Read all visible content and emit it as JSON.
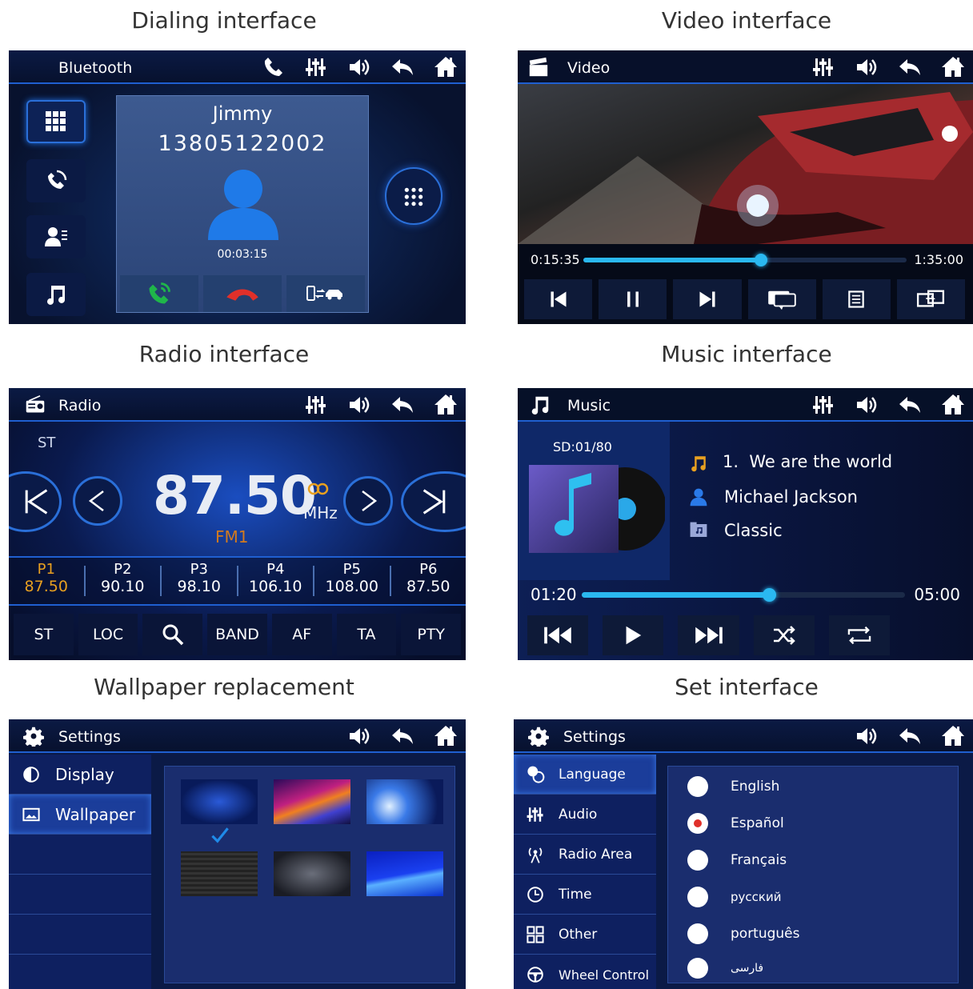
{
  "captions": {
    "dialing": "Dialing interface",
    "video": "Video interface",
    "radio": "Radio interface",
    "music": "Music interface",
    "wallpaper": "Wallpaper replacement",
    "set": "Set interface"
  },
  "dialing": {
    "title": "Bluetooth",
    "contact_name": "Jimmy",
    "phone_number": "13805122002",
    "call_duration": "00:03:15"
  },
  "video": {
    "title": "Video",
    "elapsed": "0:15:35",
    "total": "1:35:00",
    "progress": 0.55
  },
  "radio": {
    "title": "Radio",
    "stereo": "ST",
    "frequency": "87.50",
    "unit": "MHz",
    "band": "FM1",
    "presets": [
      {
        "label": "P1",
        "freq": "87.50"
      },
      {
        "label": "P2",
        "freq": "90.10"
      },
      {
        "label": "P3",
        "freq": "98.10"
      },
      {
        "label": "P4",
        "freq": "106.10"
      },
      {
        "label": "P5",
        "freq": "108.00"
      },
      {
        "label": "P6",
        "freq": "87.50"
      }
    ],
    "buttons": [
      "ST",
      "LOC",
      "BAND",
      "AF",
      "TA",
      "PTY"
    ]
  },
  "music": {
    "title": "Music",
    "track_count": "SD:01/80",
    "track": "1.  We are the world",
    "artist": "Michael Jackson",
    "album": "Classic",
    "elapsed": "01:20",
    "total": "05:00",
    "progress": 0.58
  },
  "wallpaper": {
    "title": "Settings",
    "menu": [
      "Display",
      "Wallpaper"
    ]
  },
  "settings": {
    "title": "Settings",
    "menu": [
      "Language",
      "Audio",
      "Radio Area",
      "Time",
      "Other",
      "Wheel Control"
    ],
    "languages": [
      "English",
      "Español",
      "Français",
      "русский",
      "português",
      "فارسی"
    ],
    "selected_language": "Español"
  },
  "colors": {
    "accent": "#1f6fe0",
    "preset_active": "#e8a020",
    "progress": "#2ab8f0",
    "call_green": "#1fb64a",
    "call_red": "#e0302a"
  }
}
